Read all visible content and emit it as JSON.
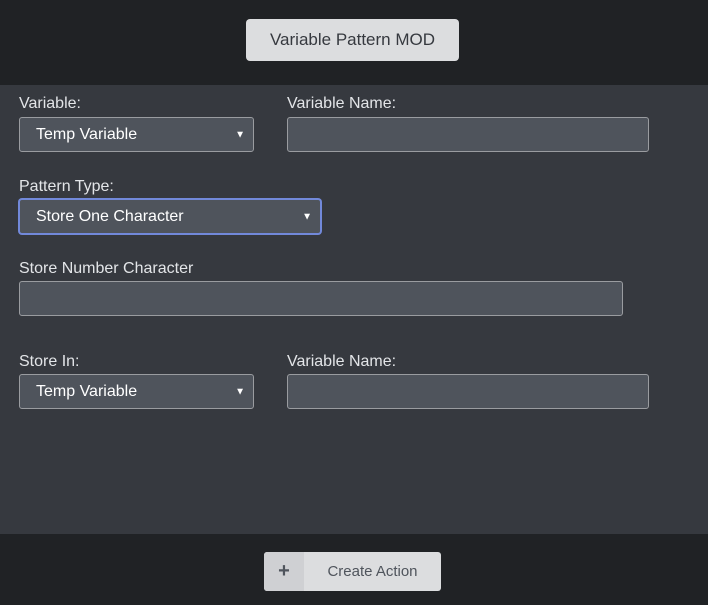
{
  "header": {
    "title": "Variable Pattern MOD"
  },
  "form": {
    "variable": {
      "label": "Variable:",
      "value": "Temp Variable"
    },
    "variable_name": {
      "label": "Variable Name:",
      "value": ""
    },
    "pattern_type": {
      "label": "Pattern Type:",
      "value": "Store One Character"
    },
    "store_number_character": {
      "label": "Store Number Character",
      "value": ""
    },
    "store_in": {
      "label": "Store In:",
      "value": "Temp Variable"
    },
    "store_in_variable_name": {
      "label": "Variable Name:",
      "value": ""
    }
  },
  "footer": {
    "plus_icon": "+",
    "create_action_label": "Create Action"
  },
  "colors": {
    "header_bg": "#202225",
    "panel_bg": "#36393f",
    "field_bg": "#4f545c",
    "focus": "#7289da"
  }
}
